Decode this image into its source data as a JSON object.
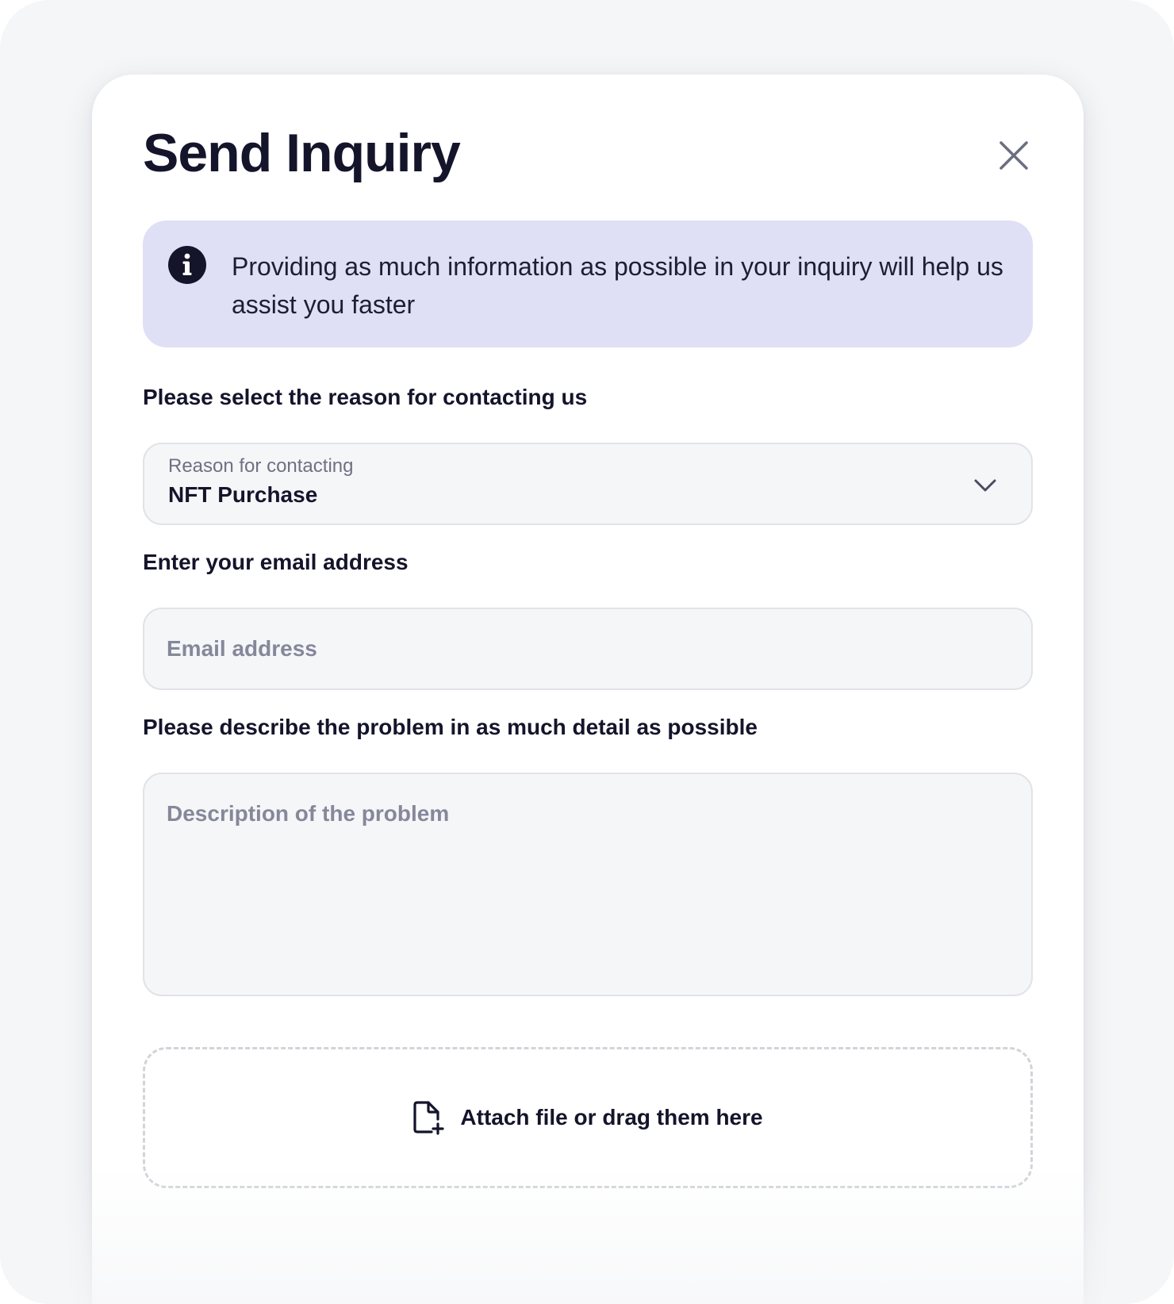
{
  "modal": {
    "title": "Send Inquiry",
    "close_icon": "close-icon"
  },
  "info": {
    "icon": "info-icon",
    "text": "Providing as much information as possible in your inquiry will help us assist you faster"
  },
  "reason": {
    "label": "Please select the reason for contacting us",
    "caption": "Reason for contacting",
    "selected_value": "NFT Purchase",
    "icon": "chevron-down-icon"
  },
  "email": {
    "label": "Enter your email address",
    "placeholder": "Email address",
    "value": ""
  },
  "description": {
    "label": "Please describe the problem in as much detail as possible",
    "placeholder": "Description of the problem",
    "value": ""
  },
  "attachment": {
    "icon": "file-add-icon",
    "label": "Attach file or drag them here"
  },
  "colors": {
    "background": "#f5f6f8",
    "modal": "#ffffff",
    "info_box": "#dfdff5",
    "text_primary": "#14142b",
    "text_placeholder": "#85889a",
    "field_border": "#e2e3e8"
  }
}
